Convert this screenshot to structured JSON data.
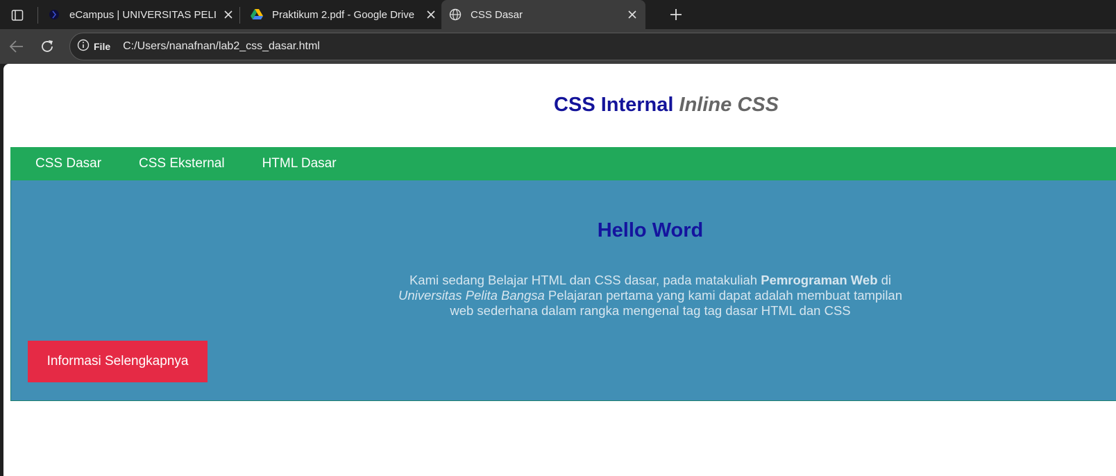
{
  "browser": {
    "tabs": [
      {
        "title": "eCampus | UNIVERSITAS PELITA B",
        "icon": "campus-logo-icon",
        "active": false
      },
      {
        "title": "Praktikum 2.pdf - Google Drive",
        "icon": "google-drive-icon",
        "active": false
      },
      {
        "title": "CSS Dasar",
        "icon": "globe-icon",
        "active": true
      }
    ],
    "address": {
      "chip_label": "File",
      "url": "C:/Users/nanafnan/lab2_css_dasar.html"
    }
  },
  "page": {
    "header": {
      "title_main": "CSS Internal",
      "title_em": "Inline CSS"
    },
    "nav": {
      "items": [
        "CSS Dasar",
        "CSS Eksternal",
        "HTML Dasar"
      ]
    },
    "hero": {
      "heading": "Hello Word",
      "text_1": "Kami sedang Belajar HTML dan CSS dasar, pada matakuliah ",
      "text_bold": "Pemrograman Web",
      "text_2": " di ",
      "text_italic": "Universitas Pelita Bangsa",
      "text_3": " Pelajaran pertama yang kami dapat adalah membuat tampilan web sederhana dalam rangka mengenal tag tag dasar HTML dan CSS",
      "button_label": "Informasi Selengkapnya"
    }
  },
  "colors": {
    "header_title": "#13139a",
    "header_em": "#666666",
    "nav_bg": "#21a95a",
    "hero_bg": "#418fb5",
    "hero_heading": "#14149e",
    "button_bg": "#e52a45"
  }
}
